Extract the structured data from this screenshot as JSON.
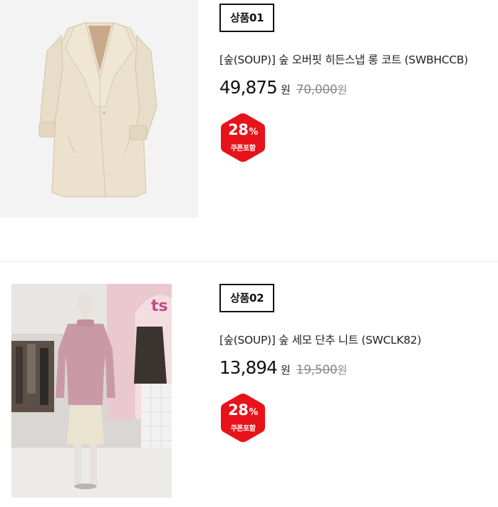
{
  "products": [
    {
      "badge": "상품01",
      "title": "[숲(SOUP)] 숲 오버핏 히든스냅 롱 코트 (SWBHCCB)",
      "price": "49,875",
      "price_unit": "원",
      "original_price": "70,000",
      "original_unit": "원",
      "discount": "28",
      "discount_unit": "%",
      "coupon_label": "쿠폰포함",
      "image_icon": "coat-icon"
    },
    {
      "badge": "상품02",
      "title": "[숲(SOUP)] 숲 세모 단추 니트 (SWCLK82)",
      "price": "13,894",
      "price_unit": "원",
      "original_price": "19,500",
      "original_unit": "원",
      "discount": "28",
      "discount_unit": "%",
      "coupon_label": "쿠폰포함",
      "image_icon": "mannequin-knit-icon",
      "store_sign": "ts"
    }
  ],
  "colors": {
    "discount_red": "#e8131a",
    "coat_cream": "#ece2cf",
    "knit_pink": "#c99aa6",
    "border": "#111111"
  }
}
